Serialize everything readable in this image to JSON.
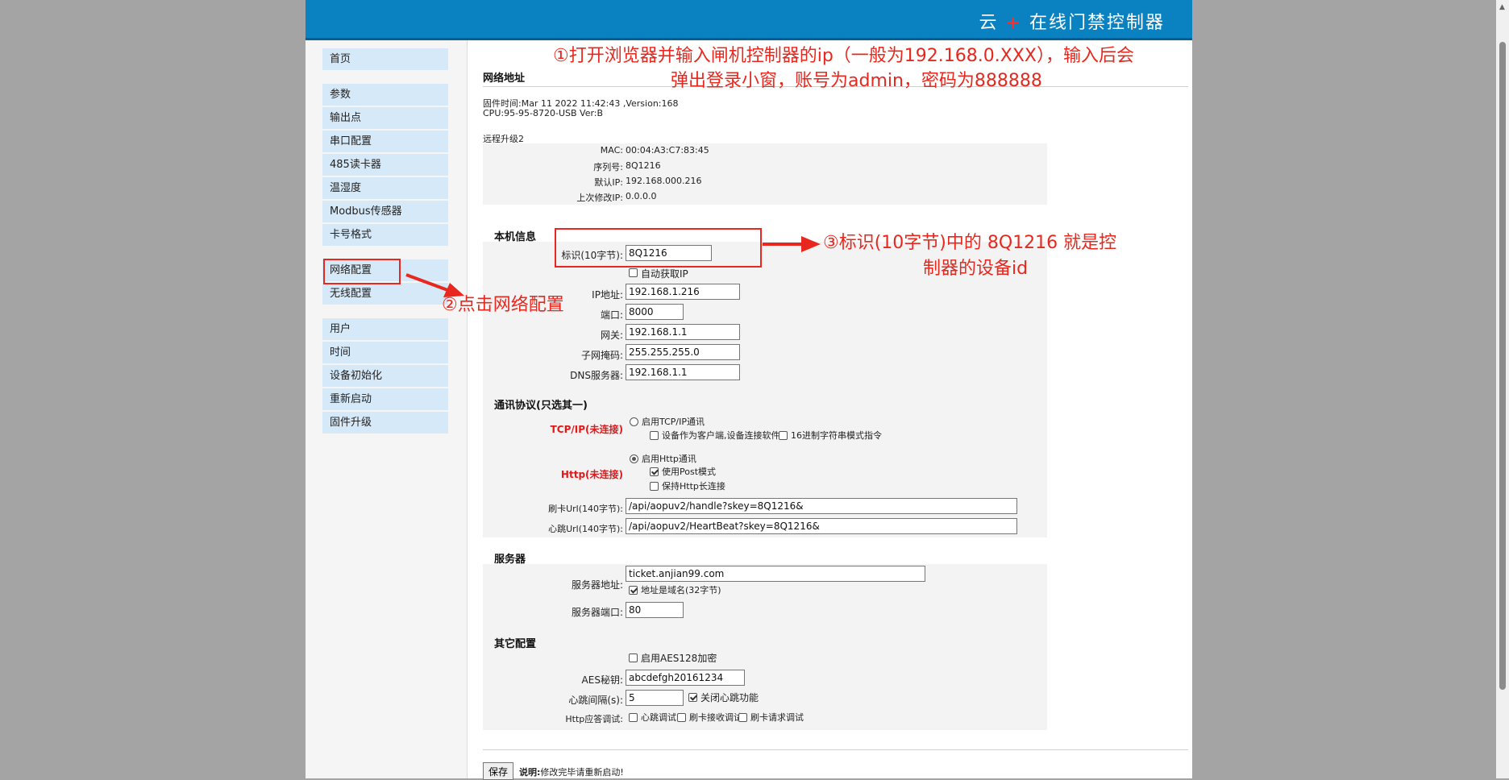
{
  "header": {
    "title_prefix": "云",
    "title_plus": "+",
    "title_rest": "在线门禁控制器"
  },
  "sidebar": {
    "groups": [
      [
        "首页"
      ],
      [
        "参数",
        "输出点",
        "串口配置",
        "485读卡器",
        "温湿度",
        "Modbus传感器",
        "卡号格式"
      ],
      [
        "网络配置",
        "无线配置"
      ],
      [
        "用户",
        "时间",
        "设备初始化",
        "重新启动",
        "固件升级"
      ]
    ]
  },
  "page": {
    "title": "网络地址",
    "firmware_line": "固件时间:Mar 11 2022 11:42:43 ,Version:168",
    "cpu_line": "CPU:95-95-8720-USB Ver:B",
    "remote_upgrade": "远程升级2",
    "info": {
      "mac_label": "MAC:",
      "mac": "00:04:A3:C7:83:45",
      "serial_label": "序列号:",
      "serial": "8Q1216",
      "default_ip_label": "默认IP:",
      "default_ip": "192.168.000.216",
      "last_ip_label": "上次修改IP:",
      "last_ip": "0.0.0.0"
    }
  },
  "local": {
    "title": "本机信息",
    "id_label": "标识(10字节):",
    "id_value": "8Q1216",
    "auto_ip_label": "自动获取IP",
    "ip_label": "IP地址:",
    "ip_value": "192.168.1.216",
    "port_label": "端口:",
    "port_value": "8000",
    "gateway_label": "网关:",
    "gateway_value": "192.168.1.1",
    "mask_label": "子网掩码:",
    "mask_value": "255.255.255.0",
    "dns_label": "DNS服务器:",
    "dns_value": "192.168.1.1"
  },
  "comm": {
    "title": "通讯协议(只选其一)",
    "tcp_status": "TCP/IP(未连接)",
    "tcp_enable": "启用TCP/IP通讯",
    "tcp_client": "设备作为客户端,设备连接软件",
    "tcp_hex": "16进制字符串模式指令",
    "http_status": "Http(未连接)",
    "http_enable": "启用Http通讯",
    "http_post": "使用Post模式",
    "http_keep": "保持Http长连接",
    "card_url_label": "刷卡Url(140字节):",
    "card_url": "/api/aopuv2/handle?skey=8Q1216&",
    "hb_url_label": "心跳Url(140字节):",
    "hb_url": "/api/aopuv2/HeartBeat?skey=8Q1216&"
  },
  "server": {
    "title": "服务器",
    "addr_label": "服务器地址:",
    "addr_value": "ticket.anjian99.com",
    "domain_label": "地址是域名(32字节)",
    "port_label": "服务器端口:",
    "port_value": "80"
  },
  "other": {
    "title": "其它配置",
    "aes_enable": "启用AES128加密",
    "aes_key_label": "AES秘钥:",
    "aes_key": "abcdefgh20161234",
    "hb_interval_label": "心跳间隔(s):",
    "hb_interval": "5",
    "hb_off": "关闭心跳功能",
    "http_debug_label": "Http应答调试:",
    "dbg_hb": "心跳调试",
    "dbg_card_recv": "刷卡接收调试",
    "dbg_card_req": "刷卡请求调试"
  },
  "footer": {
    "save": "保存",
    "note_label": "说明:",
    "note": "修改完毕请重新启动!"
  },
  "annotations": {
    "step1_line1": "①打开浏览器并输入闸机控制器的ip（一般为192.168.0.XXX），输入后会",
    "step1_line2": "弹出登录小窗，账号为admin，密码为888888",
    "step2": "②点击网络配置",
    "step3_line1": "③标识(10字节)中的 8Q1216 就是控",
    "step3_line2": "制器的设备id"
  },
  "colors": {
    "header": "#0a82c2",
    "menu": "#d6e9f8",
    "annotation": "#e8281e",
    "panel": "#f3f3f3"
  }
}
